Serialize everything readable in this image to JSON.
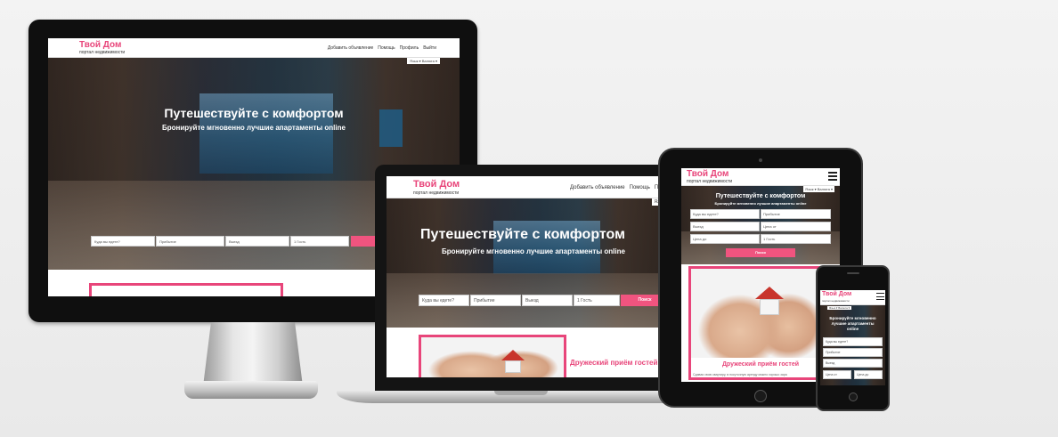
{
  "site": {
    "logo_title": "Твой Дом",
    "logo_subtitle": "портал недвижимости",
    "nav": [
      "Добавить объявление",
      "Помощь",
      "Профиль",
      "Выйти"
    ],
    "nav_short": [
      "Добавить объявление",
      "Помощь",
      "Проф"
    ],
    "lang": "Язык",
    "currency": "Валюта",
    "lang_short": "Язы",
    "hero_title": "Путешествуйте с комфортом",
    "hero_subtitle": "Бронируйте мгновенно лучшие апартаменты online",
    "phone_hero_title": "Бронируйте мгновенно лучшие апартаменты online",
    "search": {
      "where": "Куда вы едете?",
      "arrival": "Прибытие",
      "departure": "Выезд",
      "guests": "1 Гость",
      "submit": "Поиск",
      "price_from": "Цена от",
      "price_to": "Цена до"
    },
    "section_title": "Дружеский приём гостей",
    "section_text": "Сдавая свою квартиру, в посуточную аренду можно хорошо зара"
  },
  "colors": {
    "accent": "#e8457a",
    "button": "#f0547f",
    "device_black": "#0f0f0f",
    "silver": "#c9c9c9"
  },
  "icons": [
    "hamburger-icon",
    "chevron-down-icon",
    "home-button-icon",
    "camera-icon",
    "house-keys-image"
  ]
}
